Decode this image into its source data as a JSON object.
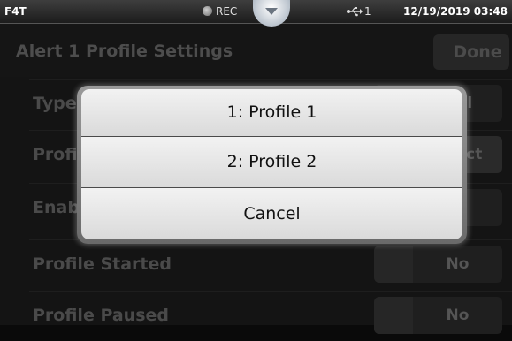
{
  "status_bar": {
    "brand": "F4T",
    "rec_label": "REC",
    "usb_count": "1",
    "datetime": "12/19/2019 03:48"
  },
  "page": {
    "title": "Alert 1 Profile Settings",
    "done_label": "Done",
    "rows": [
      {
        "label": "Type",
        "value": "al"
      },
      {
        "label": "Profi",
        "value": "ect"
      },
      {
        "label": "Enab",
        "value": ""
      },
      {
        "label": "Profile Started",
        "value": "No"
      },
      {
        "label": "Profile Paused",
        "value": "No"
      }
    ]
  },
  "dialog": {
    "options": [
      "1: Profile 1",
      "2: Profile 2"
    ],
    "cancel_label": "Cancel"
  }
}
